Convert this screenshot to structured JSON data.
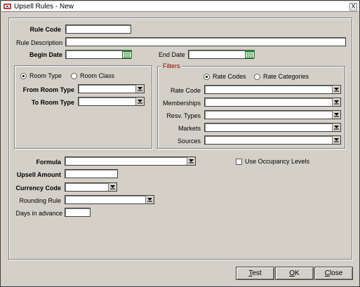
{
  "window": {
    "title": "Upsell Rules - New",
    "close_glyph": "X"
  },
  "fields": {
    "rule_code": {
      "label": "Rule Code",
      "value": ""
    },
    "rule_description": {
      "label": "Rule Description",
      "value": ""
    },
    "begin_date": {
      "label": "Begin Date",
      "value": ""
    },
    "end_date": {
      "label": "End Date",
      "value": ""
    }
  },
  "room_panel": {
    "radio_room_type": "Room Type",
    "radio_room_class": "Room Class",
    "selected": "Room Type",
    "from_room_type": {
      "label": "From Room Type",
      "value": ""
    },
    "to_room_type": {
      "label": "To Room Type",
      "value": ""
    }
  },
  "filters": {
    "title": "Filters",
    "radio_rate_codes": "Rate Codes",
    "radio_rate_categories": "Rate Categories",
    "selected": "Rate Codes",
    "rate_code": {
      "label": "Rate Code",
      "value": ""
    },
    "memberships": {
      "label": "Memberships",
      "value": ""
    },
    "resv_types": {
      "label": "Resv. Types",
      "value": ""
    },
    "markets": {
      "label": "Markets",
      "value": ""
    },
    "sources": {
      "label": "Sources",
      "value": ""
    }
  },
  "lower": {
    "formula": {
      "label": "Formula",
      "value": ""
    },
    "use_occupancy_levels": {
      "label": "Use Occupancy Levels",
      "checked": false
    },
    "upsell_amount": {
      "label": "Upsell Amount",
      "value": ""
    },
    "currency_code": {
      "label": "Currency Code",
      "value": ""
    },
    "rounding_rule": {
      "label": "Rounding Rule",
      "value": ""
    },
    "days_in_advance": {
      "label": "Days in advance",
      "value": ""
    }
  },
  "buttons": {
    "test": {
      "mnemonic": "T",
      "rest": "est"
    },
    "ok": {
      "mnemonic": "O",
      "rest": "K"
    },
    "close": {
      "mnemonic": "C",
      "rest": "lose"
    }
  },
  "icons": {
    "app": "opera-app-icon",
    "calendar": "calendar-icon",
    "dropdown": "dropdown-arrow-icon"
  },
  "colors": {
    "window_bg": "#d4d0c8",
    "filters_legend": "#8b0000",
    "calendar_accent": "#2e7d32"
  }
}
